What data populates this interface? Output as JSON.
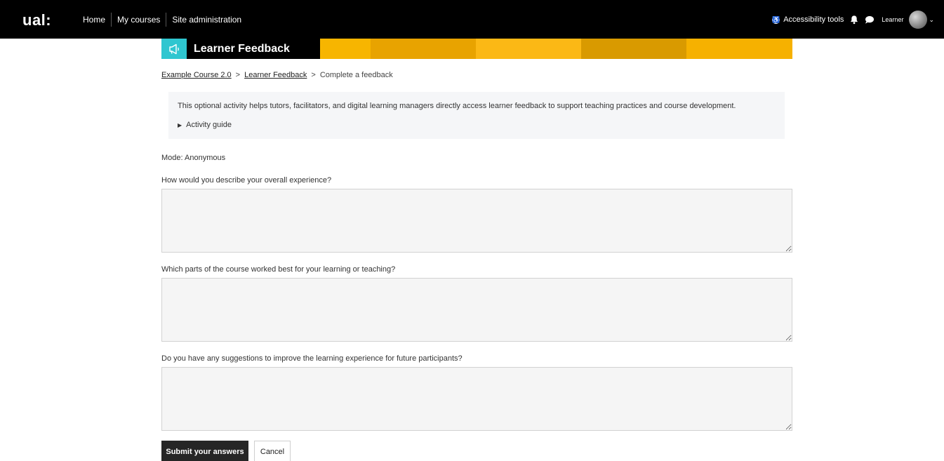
{
  "header": {
    "logo": "ual:",
    "nav": [
      "Home",
      "My courses",
      "Site administration"
    ],
    "accessibility_label": "Accessibility tools",
    "user_label": "Learner"
  },
  "banner": {
    "title": "Learner Feedback",
    "icon": "megaphone-icon",
    "colors": [
      "#2fc6d0",
      "#000000",
      "#f7b500",
      "#e8a300",
      "#fbb815",
      "#d99a00",
      "#f6b100"
    ]
  },
  "breadcrumb": {
    "course": "Example Course 2.0",
    "activity": "Learner Feedback",
    "current": "Complete a feedback",
    "separator": ">"
  },
  "info": {
    "text": "This optional activity helps tutors, facilitators, and digital learning managers directly access learner feedback to support teaching practices and course development.",
    "guide": "Activity guide"
  },
  "mode": "Mode: Anonymous",
  "questions": [
    {
      "label": "How would you describe your overall experience?",
      "value": ""
    },
    {
      "label": "Which parts of the course worked best for your learning or teaching?",
      "value": ""
    },
    {
      "label": "Do you have any suggestions to improve the learning experience for future participants?",
      "value": ""
    }
  ],
  "actions": {
    "submit": "Submit your answers",
    "cancel": "Cancel"
  }
}
